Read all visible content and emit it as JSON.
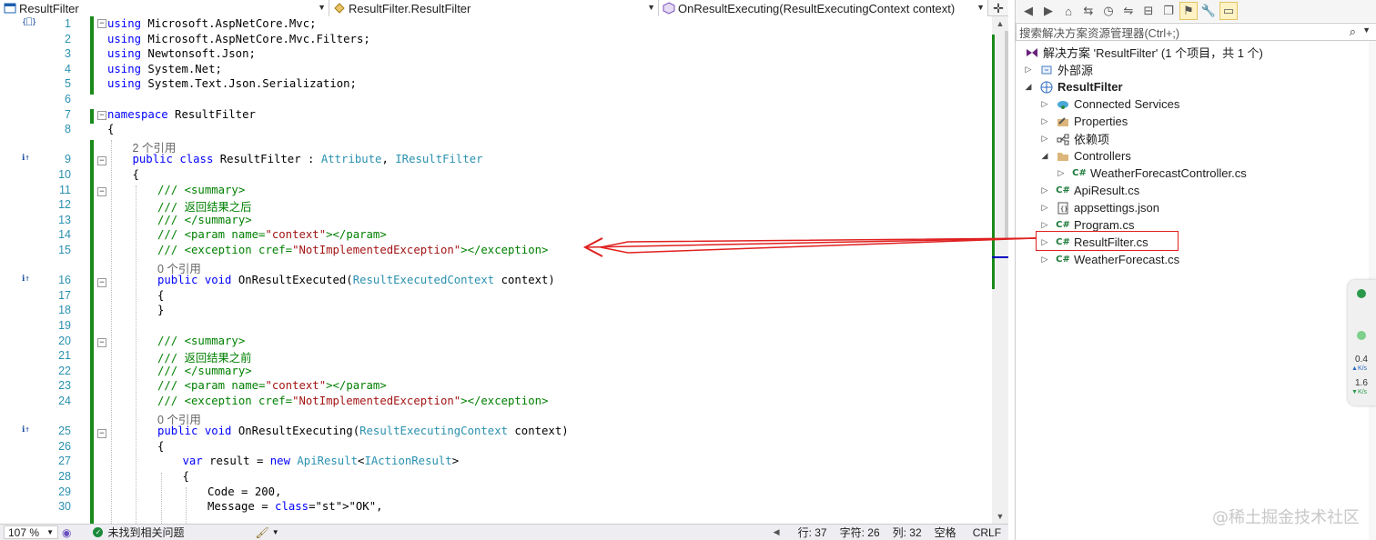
{
  "nav": {
    "project": "ResultFilter",
    "class": "ResultFilter.ResultFilter",
    "member": "OnResultExecuting(ResultExecutingContext context)"
  },
  "code": {
    "lines": [
      {
        "n": "1",
        "t": "using Microsoft.AspNetCore.Mvc;"
      },
      {
        "n": "2",
        "t": "using Microsoft.AspNetCore.Mvc.Filters;"
      },
      {
        "n": "3",
        "t": "using Newtonsoft.Json;"
      },
      {
        "n": "4",
        "t": "using System.Net;"
      },
      {
        "n": "5",
        "t": "using System.Text.Json.Serialization;"
      },
      {
        "n": "6",
        "t": ""
      },
      {
        "n": "7",
        "t": "namespace ResultFilter"
      },
      {
        "n": "8",
        "t": "{"
      },
      {
        "n": "",
        "t": "2 个引用"
      },
      {
        "n": "9",
        "t": "public class ResultFilter : Attribute, IResultFilter"
      },
      {
        "n": "10",
        "t": "{"
      },
      {
        "n": "11",
        "t": "/// <summary>"
      },
      {
        "n": "12",
        "t": "/// 返回结果之后"
      },
      {
        "n": "13",
        "t": "/// </summary>"
      },
      {
        "n": "14",
        "t": "/// <param name=\"context\"></param>"
      },
      {
        "n": "15",
        "t": "/// <exception cref=\"NotImplementedException\"></exception>"
      },
      {
        "n": "",
        "t": "0 个引用"
      },
      {
        "n": "16",
        "t": "public void OnResultExecuted(ResultExecutedContext context)"
      },
      {
        "n": "17",
        "t": "{"
      },
      {
        "n": "18",
        "t": "}"
      },
      {
        "n": "19",
        "t": ""
      },
      {
        "n": "20",
        "t": "/// <summary>"
      },
      {
        "n": "21",
        "t": "/// 返回结果之前"
      },
      {
        "n": "22",
        "t": "/// </summary>"
      },
      {
        "n": "23",
        "t": "/// <param name=\"context\"></param>"
      },
      {
        "n": "24",
        "t": "/// <exception cref=\"NotImplementedException\"></exception>"
      },
      {
        "n": "",
        "t": "0 个引用"
      },
      {
        "n": "25",
        "t": "public void OnResultExecuting(ResultExecutingContext context)"
      },
      {
        "n": "26",
        "t": "{"
      },
      {
        "n": "27",
        "t": "var result = new ApiResult<IActionResult>"
      },
      {
        "n": "28",
        "t": "{"
      },
      {
        "n": "29",
        "t": "Code = 200,"
      },
      {
        "n": "30",
        "t": "Message = \"OK\","
      }
    ]
  },
  "status": {
    "zoom": "107 %",
    "issues": "未找到相关问题",
    "line": "行: 37",
    "char": "字符: 26",
    "col": "列: 32",
    "whitespace": "空格",
    "eol": "CRLF"
  },
  "solution": {
    "search_placeholder": "搜索解决方案资源管理器(Ctrl+;)",
    "root": "解决方案 'ResultFilter' (1 个项目，共 1 个)",
    "nodes": [
      {
        "label": "外部源"
      },
      {
        "label": "ResultFilter"
      },
      {
        "label": "Connected Services"
      },
      {
        "label": "Properties"
      },
      {
        "label": "依赖项"
      },
      {
        "label": "Controllers"
      },
      {
        "label": "WeatherForecastController.cs"
      },
      {
        "label": "ApiResult.cs"
      },
      {
        "label": "appsettings.json"
      },
      {
        "label": "Program.cs"
      },
      {
        "label": "ResultFilter.cs"
      },
      {
        "label": "WeatherForecast.cs"
      }
    ]
  },
  "widget": {
    "up": "0.4",
    "down": "1.6",
    "unit": "K/s"
  },
  "watermark": "@稀土掘金技术社区",
  "colors": {
    "keyword": "#0000ff",
    "type": "#2b91af",
    "comment": "#008000",
    "string": "#a31515",
    "change_bar": "#1a8a1a",
    "highlight": "#e02020"
  }
}
